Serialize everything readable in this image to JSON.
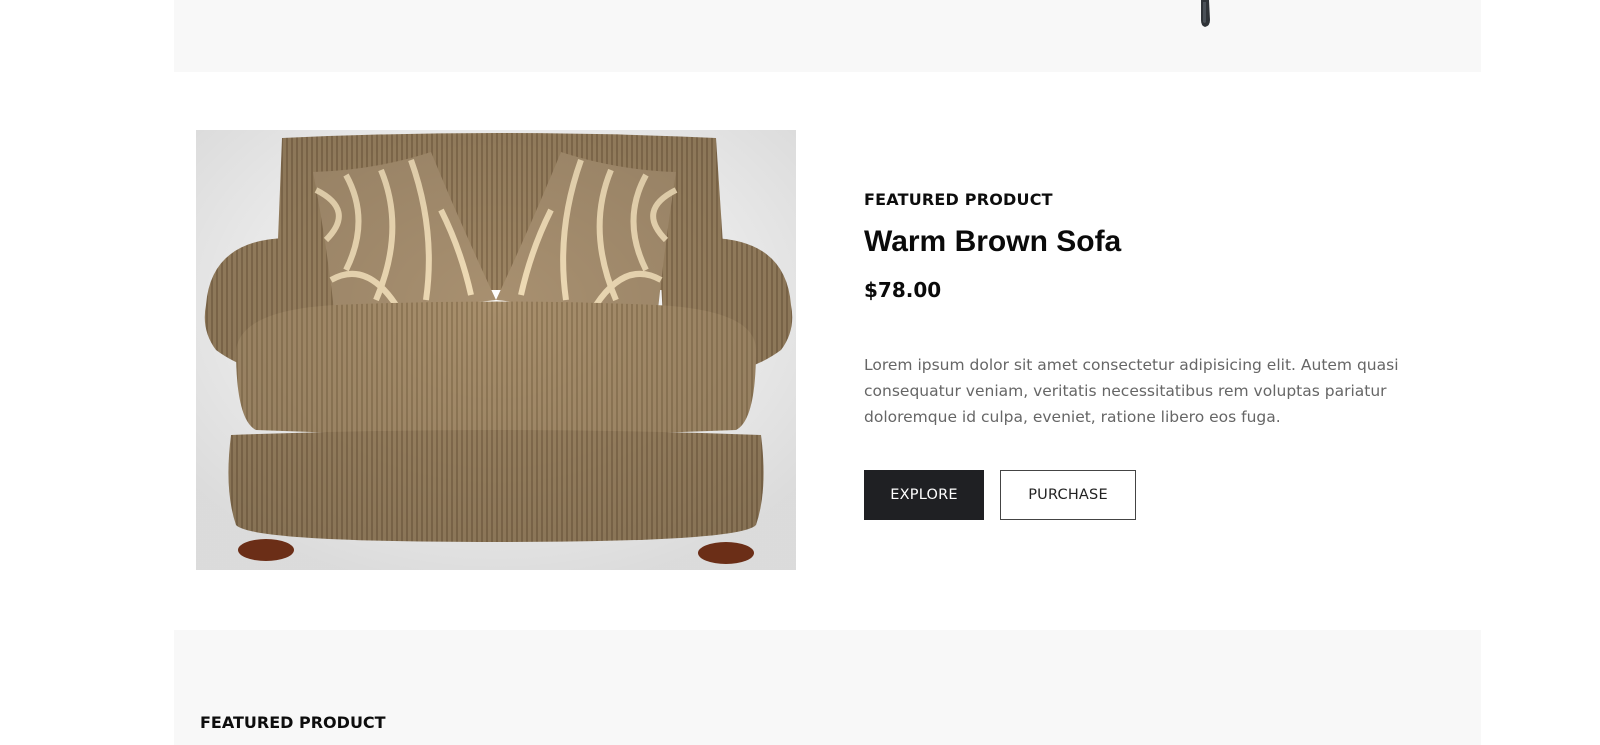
{
  "featured": {
    "eyebrow": "FEATURED PRODUCT",
    "title": "Warm Brown Sofa",
    "price": "$78.00",
    "description": "Lorem ipsum dolor sit amet consectetur adipisicing elit. Autem quasi consequatur veniam, veritatis necessitatibus rem voluptas pariatur doloremque id culpa, eveniet, ratione libero eos fuga.",
    "explore_label": "EXPLORE",
    "purchase_label": "PURCHASE",
    "image_icon": "sofa-image"
  },
  "next_section": {
    "eyebrow": "FEATURED PRODUCT"
  },
  "colors": {
    "band": "#f8f8f8",
    "primary_button": "#1f2023",
    "text_muted": "#666666"
  }
}
